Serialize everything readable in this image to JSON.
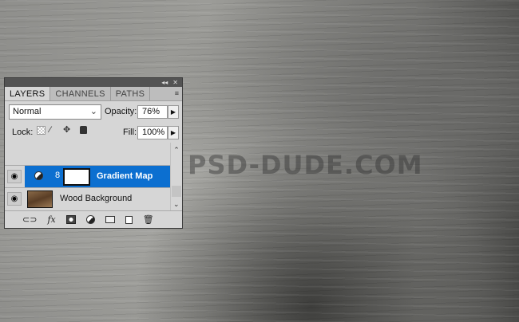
{
  "watermark": "PSD-DUDE.COM",
  "panel": {
    "title_controls": {
      "collapse": "◂◂",
      "close": "✕"
    },
    "tabs": [
      {
        "label": "LAYERS",
        "active": true
      },
      {
        "label": "CHANNELS",
        "active": false
      },
      {
        "label": "PATHS",
        "active": false
      }
    ],
    "menu_icon": "≡",
    "blend_mode": "Normal",
    "opacity_label": "Opacity:",
    "opacity_value": "76%",
    "lock_label": "Lock:",
    "fill_label": "Fill:",
    "fill_value": "100%",
    "layers": [
      {
        "name": "Gradient Map",
        "selected": true,
        "visible": true,
        "type": "adjustment"
      },
      {
        "name": "Wood Background",
        "selected": false,
        "visible": true,
        "type": "image"
      }
    ],
    "bottom_icons": [
      "link-icon",
      "fx-icon",
      "mask-icon",
      "adjustment-icon",
      "folder-icon",
      "new-layer-icon",
      "trash-icon"
    ],
    "fx_label": "fx",
    "colors": {
      "selection": "#0c6fd0"
    }
  }
}
